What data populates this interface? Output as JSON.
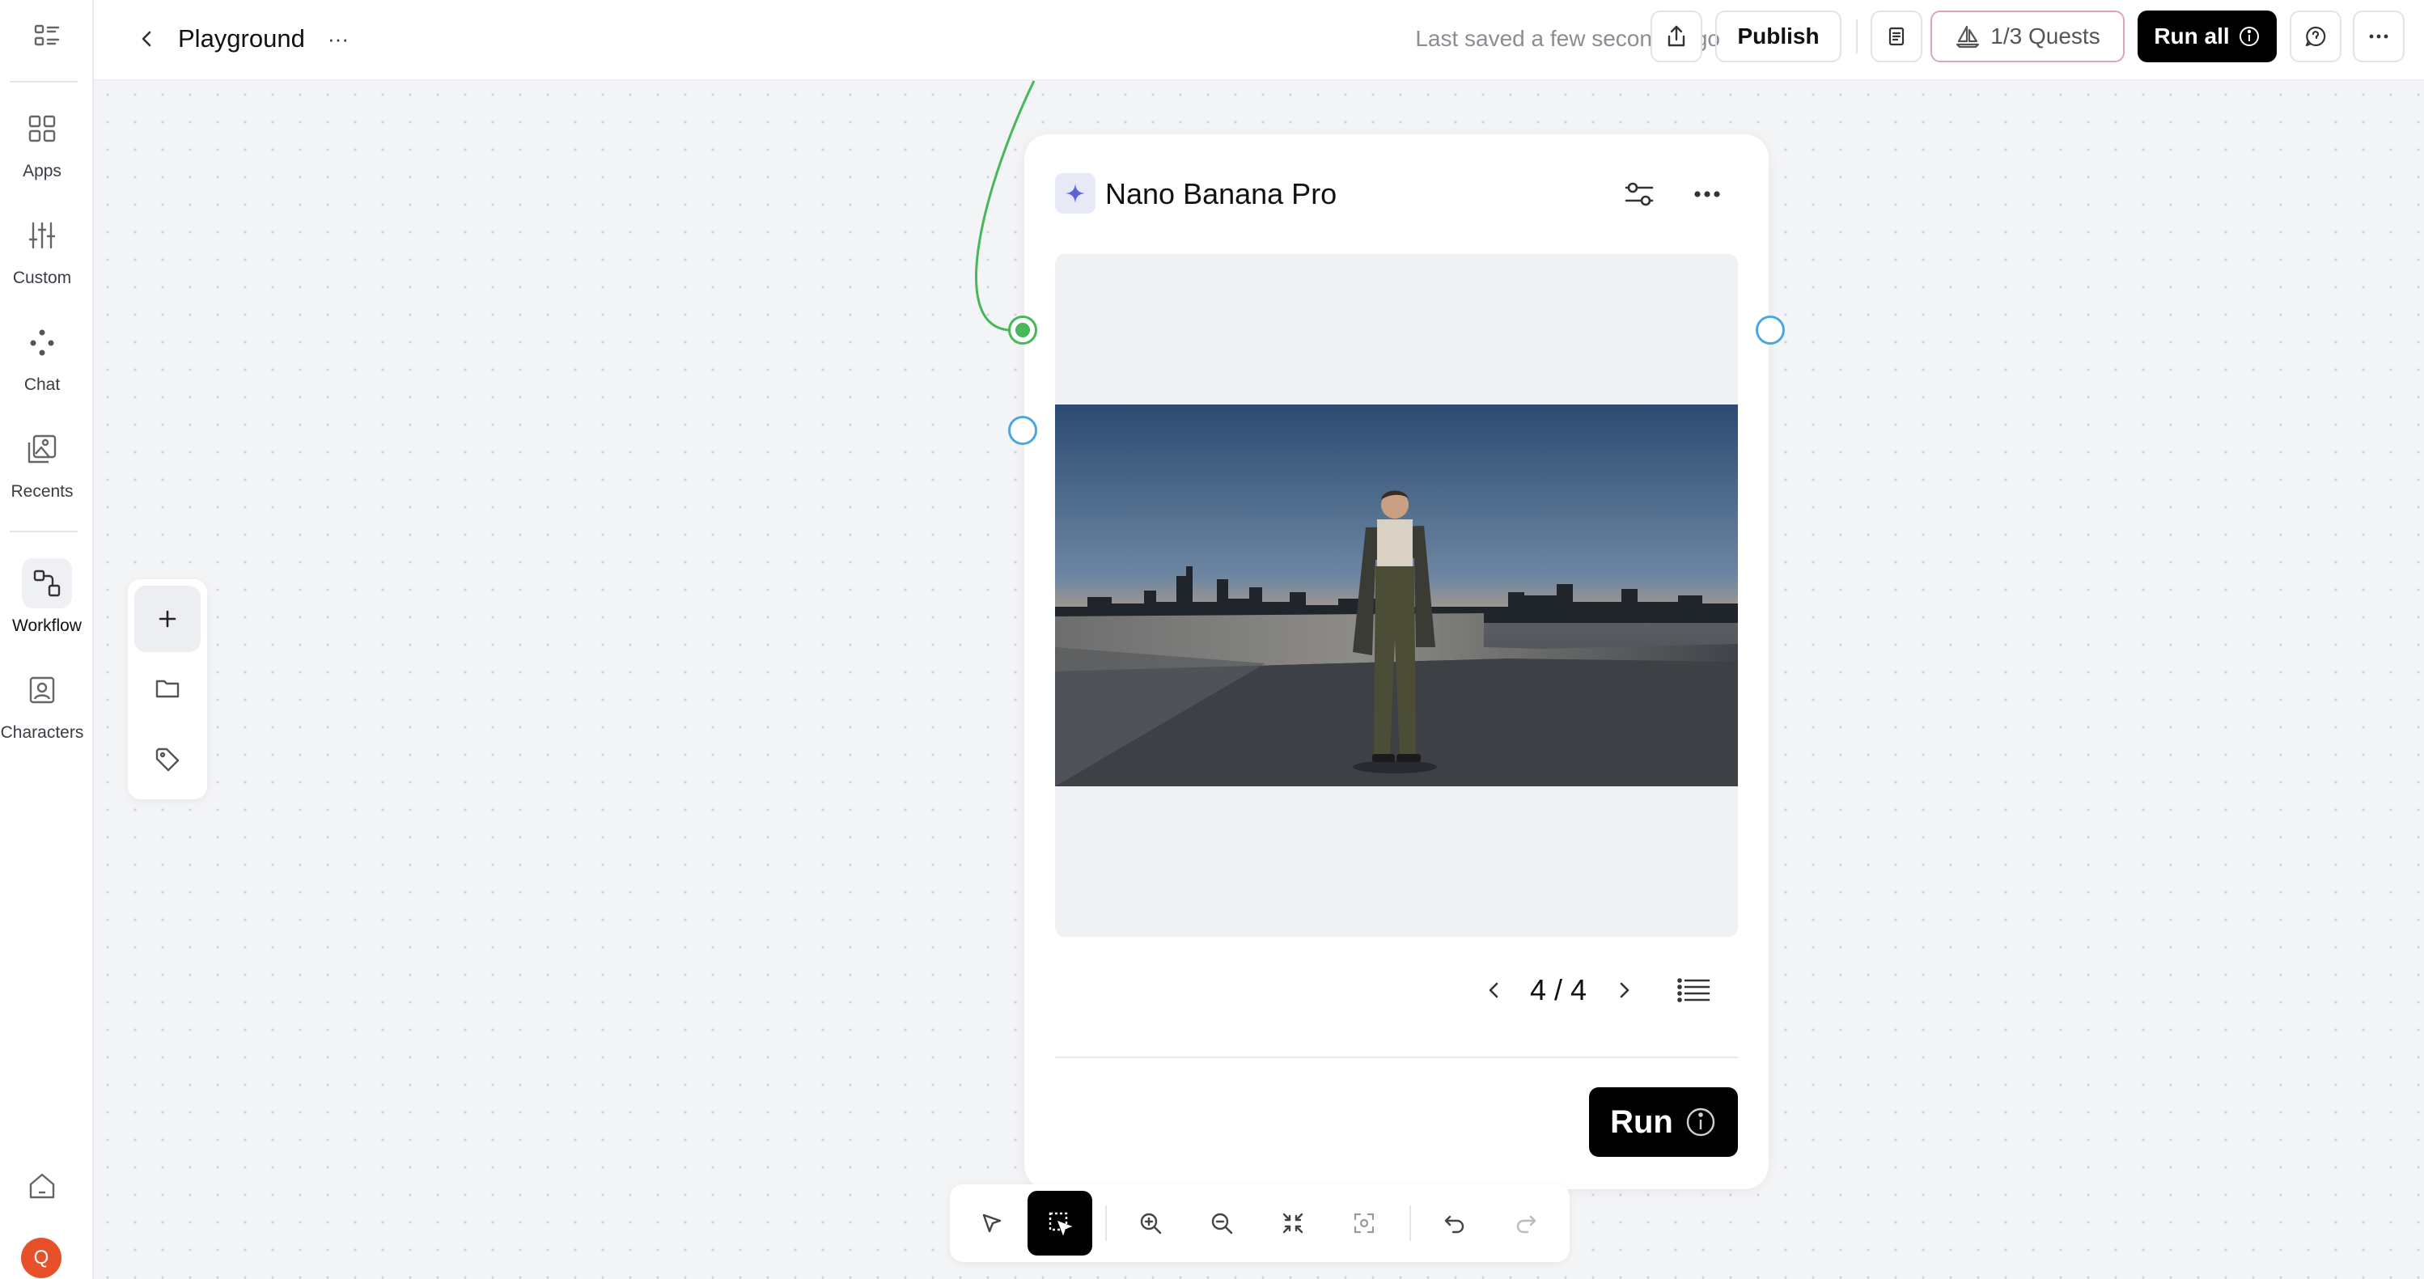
{
  "sidebar": {
    "items": [
      {
        "label": "Apps",
        "icon": "grid-icon"
      },
      {
        "label": "Custom",
        "icon": "sliders-icon"
      },
      {
        "label": "Chat",
        "icon": "nodes-icon"
      },
      {
        "label": "Recents",
        "icon": "images-icon"
      },
      {
        "label": "Workflow",
        "icon": "workflow-icon",
        "active": true
      },
      {
        "label": "Characters",
        "icon": "portrait-icon"
      }
    ],
    "avatar_initial": "Q"
  },
  "header": {
    "title": "Playground",
    "more_label": "···",
    "saved_status": "Last saved a few seconds ago",
    "publish_label": "Publish",
    "quests_label": "1/3 Quests",
    "run_all_label": "Run all"
  },
  "node": {
    "title": "Nano Banana Pro",
    "pager": "4 / 4",
    "run_label": "Run",
    "image_description_icon": "photo-icon"
  },
  "colors": {
    "accent_dark": "#000000",
    "port_active": "#46b85a",
    "port_idle": "#4aa7e0",
    "quests_border": "#e1a4b0",
    "avatar": "#e8502a",
    "badge_star": "#5a66d6"
  }
}
